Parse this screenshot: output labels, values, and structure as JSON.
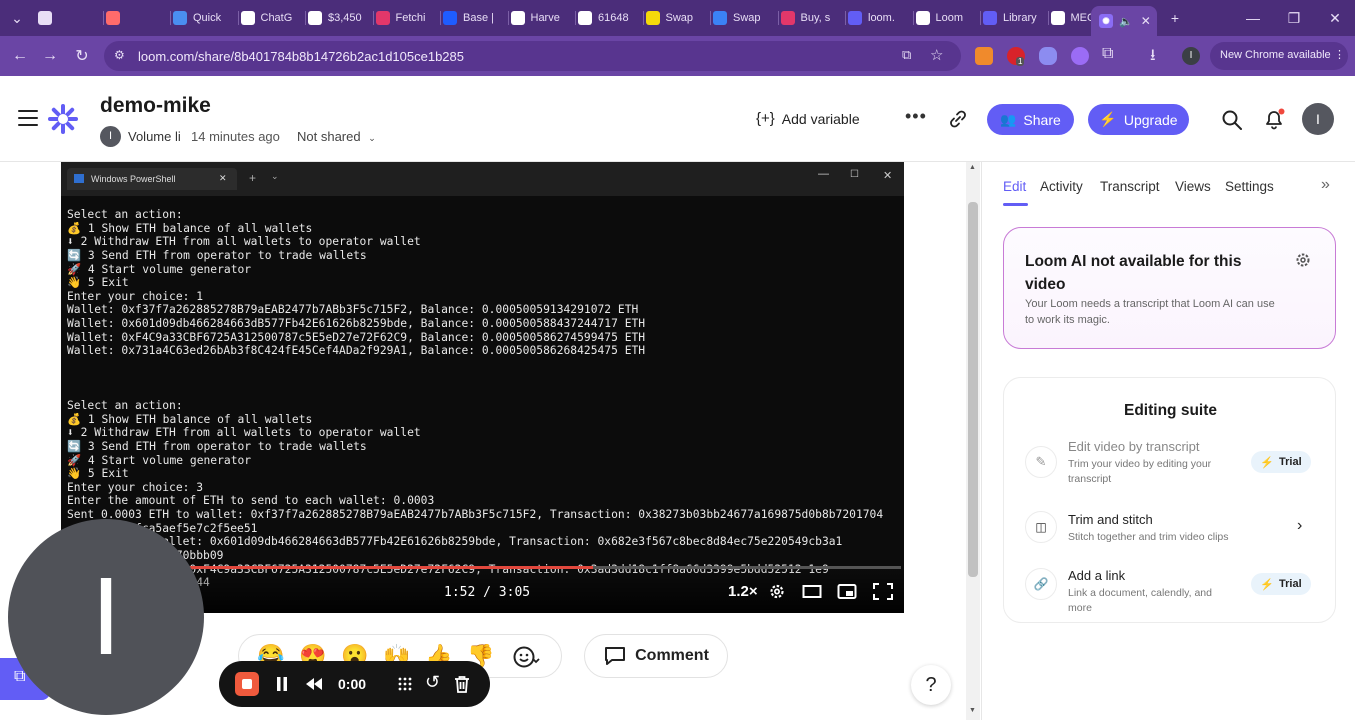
{
  "browser": {
    "tabs": [
      {
        "label": "",
        "color": "#e8def6"
      },
      {
        "label": "",
        "color": "#ff6b6b"
      },
      {
        "label": "Quick",
        "color": "#4a8ef0"
      },
      {
        "label": "ChatG",
        "color": "#ffffff"
      },
      {
        "label": "$3,450",
        "color": "#ffffff"
      },
      {
        "label": "Fetchi",
        "color": "#e2376a"
      },
      {
        "label": "Base |",
        "color": "#1f5cff"
      },
      {
        "label": "Harve",
        "color": "#ffffff"
      },
      {
        "label": "61648",
        "color": "#ffffff"
      },
      {
        "label": "Swap",
        "color": "#f5d90a"
      },
      {
        "label": "Swap",
        "color": "#3b82f6"
      },
      {
        "label": "Buy, s",
        "color": "#e2376a"
      },
      {
        "label": "loom.",
        "color": "#625df5"
      },
      {
        "label": "Loom",
        "color": "#ffffff"
      },
      {
        "label": "Library",
        "color": "#625df5"
      },
      {
        "label": "MEOW",
        "color": "#ffffff"
      }
    ],
    "active_tab": {
      "label": "",
      "audio_icon": "speaker-icon"
    },
    "url": "loom.com/share/8b401784b8b14726b2ac1d105ce1b285",
    "update_label": "New Chrome available",
    "profile_initial": "I",
    "extension_badge": "1"
  },
  "header": {
    "title": "demo-mike",
    "owner_initial": "I",
    "owner_name": "Volume li",
    "time": "14 minutes ago",
    "share_status": "Not shared",
    "add_variable": "Add variable",
    "share": "Share",
    "upgrade": "Upgrade",
    "user_initial": "I"
  },
  "video": {
    "window_title": "Windows PowerShell",
    "terminal_lines": [
      "Select an action:",
      "💰 1 Show ETH balance of all wallets",
      "⬇ 2 Withdraw ETH from all wallets to operator wallet",
      "🔄 3 Send ETH from operator to trade wallets",
      "🚀 4 Start volume generator",
      "👋 5 Exit",
      "Enter your choice: 1",
      "Wallet: 0xf37f7a262885278B79aEAB2477b7ABb3F5c715F2, Balance: 0.000500591342910​72 ETH",
      "Wallet: 0x601d09db466284663dB577Fb42E61626b8259bde, Balance: 0.000500588437244717 ETH",
      "Wallet: 0xF4C9a33CBF6725A312500787c5E5eD27e72F62C9, Balance: 0.000500586274599475 ETH",
      "Wallet: 0x731a4C63ed26bAb3f8C424fE45Cef4ADa2f929A1, Balance: 0.000500586268425475 ETH",
      "",
      "",
      "",
      "Select an action:",
      "💰 1 Show ETH balance of all wallets",
      "⬇ 2 Withdraw ETH from all wallets to operator wallet",
      "🔄 3 Send ETH from operator to trade wallets",
      "🚀 4 Start volume generator",
      "👋 5 Exit",
      "Enter your choice: 3",
      "Enter the amount of ETH to send to each wallet: 0.0003",
      "Sent 0.0003 ETH to wallet: 0xf37f7a262885278B79aEAB2477b7ABb3F5c715F2, Transaction: 0x38273b03bb24677a169875d0b8b7201704",
      "          fca5aef5e7c2f5ee51",
      "          to wallet: 0x601d09db466284663dB577Fb42E61626b8259bde, Transaction: 0x682e3f567c8bec8d84ec75e220549cb3a1",
      "          369f4070bbb09",
      "          wallet: 0xF4C9a33CBF6725A312500787c5E5eD27e72F62C9, Transaction: 0x3ad3dd18c1ff8a66d3399e5bdd52512 1e9",
      "          083d732bd44"
    ],
    "time_display": "1:52 / 3:05",
    "progress": 0.605,
    "speed": "1.2×"
  },
  "reactions": [
    "😂",
    "😍",
    "😮",
    "🙌",
    "👍",
    "👎"
  ],
  "comment_label": "Comment",
  "recorder": {
    "time": "0:00"
  },
  "help_label": "?",
  "camera_initial": "I",
  "sidebar": {
    "tabs": [
      "Edit",
      "Activity",
      "Transcript",
      "Views",
      "Settings"
    ],
    "ai_title": "Loom AI not available for this video",
    "ai_desc": "Your Loom needs a transcript that Loom AI can use to work its magic.",
    "suite_title": "Editing suite",
    "features": [
      {
        "title": "Edit video by transcript",
        "desc": "Trim your video by editing your transcript",
        "badge": "Trial"
      },
      {
        "title": "Trim and stitch",
        "desc": "Stitch together and trim video clips"
      },
      {
        "title": "Add a link",
        "desc": "Link a document, calendly, and more",
        "badge": "Trial"
      }
    ]
  },
  "colors": {
    "accent": "#625df5",
    "browser_frame": "#6a45a5",
    "record": "#f05a3d"
  }
}
